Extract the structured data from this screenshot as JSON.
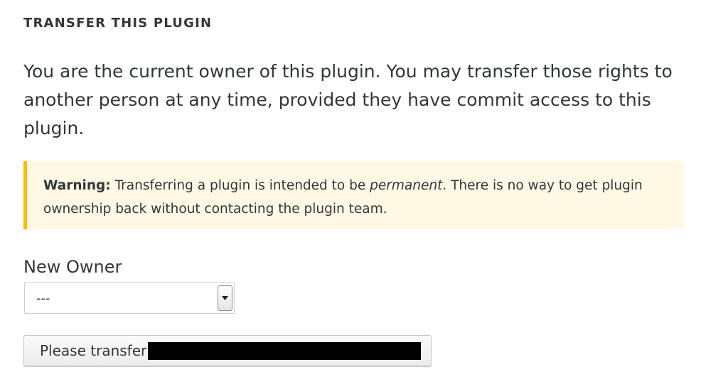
{
  "section": {
    "title": "TRANSFER THIS PLUGIN",
    "description": "You are the current owner of this plugin. You may transfer those rights to another person at any time, provided they have commit access to this plugin."
  },
  "warning": {
    "label": "Warning:",
    "text_before": "Transferring a plugin is intended to be",
    "emphasis": "permanent",
    "text_after": ". There is no way to get plugin ownership back without contacting the plugin team."
  },
  "form": {
    "new_owner_label": "New Owner",
    "new_owner_selected": "---",
    "submit_label_prefix": "Please transfer"
  },
  "icons": {
    "dropdown": "caret-down-icon"
  },
  "colors": {
    "text": "#32373c",
    "warning_bg": "#fff8e5",
    "warning_border": "#ffb900"
  }
}
